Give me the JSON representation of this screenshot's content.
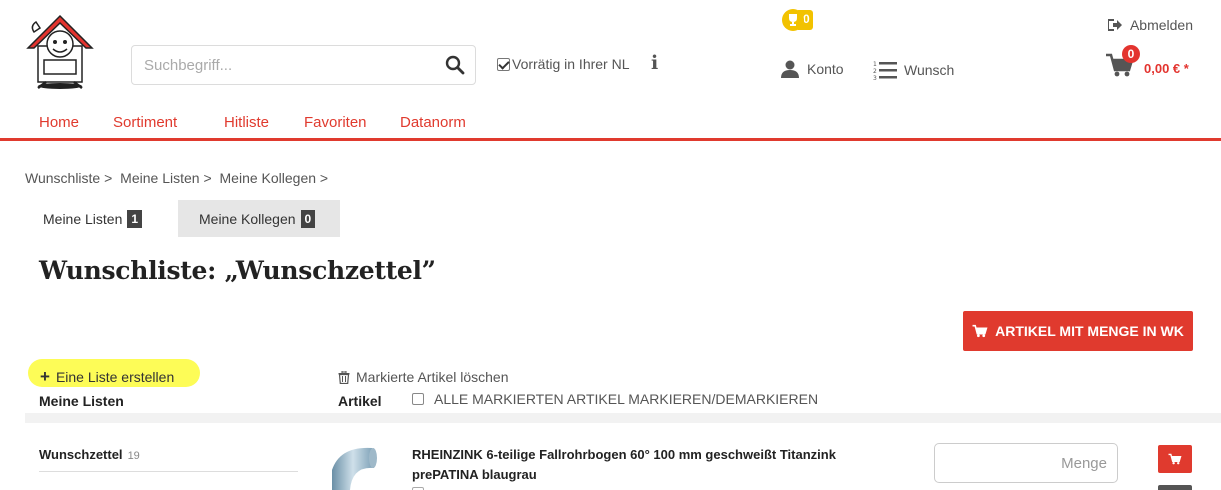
{
  "header": {
    "search_placeholder": "Suchbegriff...",
    "stock_label": "Vorrätig in Ihrer NL",
    "trophy_count": "0",
    "account_label": "Konto",
    "wish_label": "Wunsch",
    "logout_label": "Abmelden",
    "cart_count": "0",
    "cart_total": "0,00 € *"
  },
  "nav": {
    "items": [
      "Home",
      "Sortiment",
      "Hitliste",
      "Favoriten",
      "Datanorm"
    ]
  },
  "breadcrumb": [
    "Wunschliste >",
    "Meine Listen >",
    "Meine Kollegen >"
  ],
  "tabs": [
    {
      "label": "Meine Listen",
      "count": "1"
    },
    {
      "label": "Meine Kollegen",
      "count": "0"
    }
  ],
  "page": {
    "title": "Wunschliste: „Wunschzettel”",
    "add_to_cart_label": "ARTIKEL MIT MENGE IN WK",
    "create_list_label": "Eine Liste erstellen",
    "delete_marked_label": "Markierte Artikel löschen",
    "lists_header": "Meine Listen",
    "articles_header": "Artikel",
    "mark_all_label": "ALLE MARKIERTEN ARTIKEL MARKIEREN/DEMARKIEREN"
  },
  "lists": [
    {
      "name": "Wunschzettel",
      "count": "19"
    }
  ],
  "articles": [
    {
      "title": "RHEINZINK 6-teilige Fallrohrbogen 60° 100 mm geschweißt Titanzink prePATINA blaugrau",
      "qty_placeholder": "Menge"
    }
  ],
  "colors": {
    "accent": "#e03a2e",
    "trophy": "#f2c200",
    "highlight": "#fdfc3a"
  },
  "icons": [
    "logo-house",
    "search-icon",
    "info-icon",
    "trophy-icon",
    "user-icon",
    "list-icon",
    "logout-icon",
    "cart-icon",
    "trash-icon",
    "plus-icon"
  ]
}
